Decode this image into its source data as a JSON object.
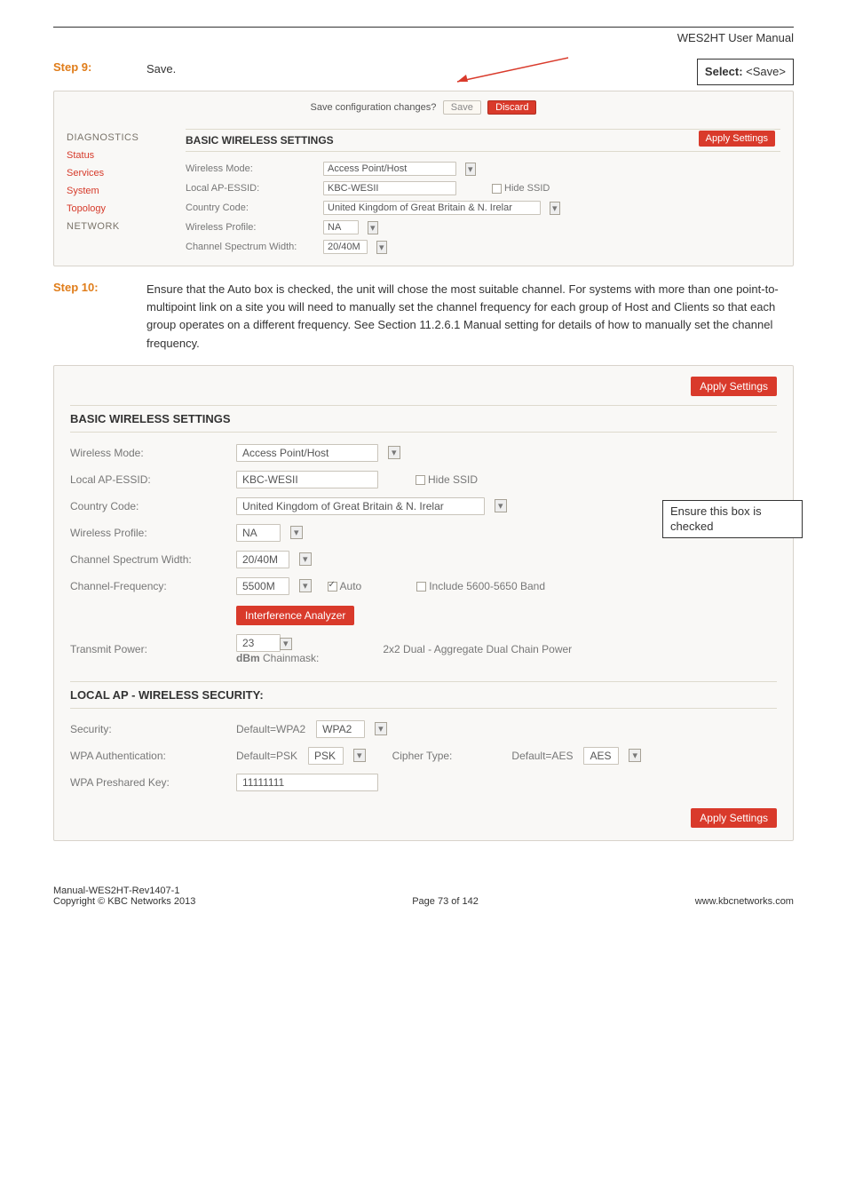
{
  "header": {
    "title": "WES2HT User Manual"
  },
  "step9": {
    "label": "Step 9:",
    "action": "Save.",
    "select_prefix": "Select:  ",
    "select_value": "<Save>"
  },
  "shot1": {
    "save_question": "Save configuration changes?",
    "save_btn": "Save",
    "discard_btn": "Discard",
    "apply_btn": "Apply Settings",
    "nav": {
      "diagnostics": "DIAGNOSTICS",
      "status": "Status",
      "services": "Services",
      "system": "System",
      "topology": "Topology",
      "network": "NETWORK"
    },
    "section_title": "BASIC WIRELESS SETTINGS",
    "rows": {
      "wireless_mode_lbl": "Wireless Mode:",
      "wireless_mode_val": "Access Point/Host",
      "local_ap_lbl": "Local AP-ESSID:",
      "local_ap_val": "KBC-WESII",
      "hide_ssid": "Hide SSID",
      "country_lbl": "Country Code:",
      "country_val": "United Kingdom of Great Britain & N. Irelar",
      "profile_lbl": "Wireless Profile:",
      "profile_val": "NA",
      "csw_lbl": "Channel Spectrum Width:",
      "csw_val": "20/40M"
    }
  },
  "step10": {
    "label": "Step 10:",
    "text": "Ensure that the Auto box is checked, the unit will chose the most suitable channel. For systems with more than one point-to-multipoint link on a site you will need to manually set the channel frequency for each group of Host and Clients so that each group operates on a different frequency. See Section 11.2.6.1 Manual setting for details of how to manually set the channel frequency."
  },
  "shot2": {
    "apply_btn": "Apply Settings",
    "section1": "BASIC WIRELESS SETTINGS",
    "wireless_mode_lbl": "Wireless Mode:",
    "wireless_mode_val": "Access Point/Host",
    "local_ap_lbl": "Local AP-ESSID:",
    "local_ap_val": "KBC-WESII",
    "hide_ssid": "Hide SSID",
    "country_lbl": "Country Code:",
    "country_val": "United Kingdom of Great Britain & N. Irelar",
    "profile_lbl": "Wireless Profile:",
    "profile_val": "NA",
    "csw_lbl": "Channel Spectrum Width:",
    "csw_val": "20/40M",
    "freq_lbl": "Channel-Frequency:",
    "freq_val": "5500M",
    "auto_lbl": "Auto",
    "include_lbl": "Include 5600-5650 Band",
    "interference_btn": "Interference Analyzer",
    "tx_lbl": "Transmit Power:",
    "tx_val": "23",
    "dbm_lbl": "dBm Chainmask:",
    "chain_info": "2x2 Dual - Aggregate Dual Chain Power",
    "section2": "LOCAL AP - WIRELESS SECURITY:",
    "security_lbl": "Security:",
    "security_def": "Default=WPA2",
    "security_val": "WPA2",
    "wpa_auth_lbl": "WPA Authentication:",
    "wpa_auth_def": "Default=PSK",
    "wpa_auth_val": "PSK",
    "cipher_lbl": "Cipher Type:",
    "cipher_def": "Default=AES",
    "cipher_val": "AES",
    "psk_lbl": "WPA Preshared Key:",
    "psk_val": "11111111",
    "ensure_callout": "Ensure this box is checked"
  },
  "footer": {
    "left1": "Manual-WES2HT-Rev1407-1",
    "left2": "Copyright © KBC Networks 2013",
    "center": "Page 73 of 142",
    "right": "www.kbcnetworks.com"
  }
}
